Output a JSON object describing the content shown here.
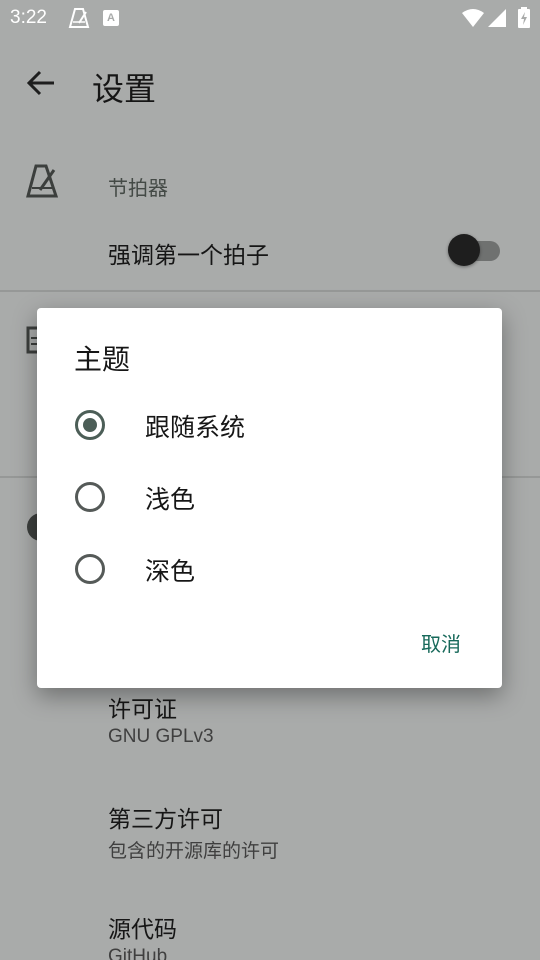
{
  "status_bar": {
    "time": "3:22",
    "notification_badge": "A",
    "icons": [
      "metronome-icon",
      "font-icon",
      "wifi-icon",
      "signal-icon",
      "battery-icon"
    ]
  },
  "app_bar": {
    "title": "设置",
    "back_icon": "back-arrow-icon"
  },
  "settings": {
    "metronome": {
      "category": "节拍器",
      "icon": "metronome-icon",
      "accent_first_beat": {
        "label": "强调第一个拍子",
        "enabled": false
      }
    },
    "about": {
      "license": {
        "title": "许可证",
        "summary": "GNU GPLv3"
      },
      "third_party": {
        "title": "第三方许可",
        "summary": "包含的开源库的许可"
      },
      "source_code": {
        "title": "源代码",
        "summary": "GitHub"
      }
    }
  },
  "theme_dialog": {
    "title": "主题",
    "options": [
      {
        "label": "跟随系统",
        "selected": true
      },
      {
        "label": "浅色",
        "selected": false
      },
      {
        "label": "深色",
        "selected": false
      }
    ],
    "cancel_label": "取消"
  },
  "colors": {
    "scrim_background": "#a9abaa",
    "accent": "#17695a",
    "radio_checked": "#4c5e57"
  }
}
